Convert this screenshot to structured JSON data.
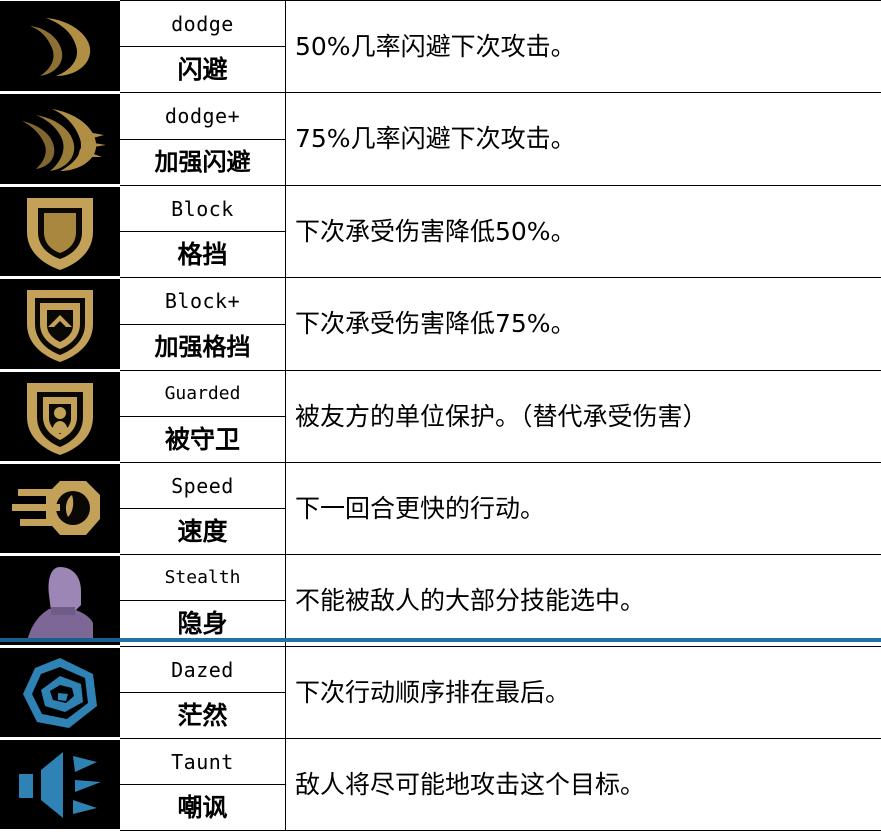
{
  "document": {
    "kind": "status-effect-reference-table",
    "column_count": 3,
    "row_count": 9,
    "separator_color": "#1f72a8",
    "icon_background": "#000000",
    "grid_color": "#000000",
    "page_background": "#ffffff"
  },
  "palette": {
    "gold_light": "#c9a85f",
    "gold_mid": "#a8873f",
    "gold_dark": "#6d5626",
    "purple_light": "#9b86b5",
    "purple_mid": "#7d6796",
    "blue_light": "#3f90c4",
    "blue_mid": "#2a7ba8",
    "blue_dark": "#1b5e8c",
    "black": "#000000",
    "white": "#ffffff"
  },
  "rows": [
    {
      "icon": "crescent-double-icon",
      "icon_color": "#a8873f",
      "name_en": "dodge",
      "name_cn": "闪避",
      "description": "50%几率闪避下次攻击。"
    },
    {
      "icon": "crescent-triple-icon",
      "icon_color": "#a8873f",
      "name_en": "dodge+",
      "name_cn": "加强闪避",
      "description": "75%几率闪避下次攻击。"
    },
    {
      "icon": "shield-icon",
      "icon_color": "#c9a85f",
      "name_en": "Block",
      "name_cn": "格挡",
      "description": "下次承受伤害降低50%。"
    },
    {
      "icon": "shield-chevron-icon",
      "icon_color": "#c9a85f",
      "name_en": "Block+",
      "name_cn": "加强格挡",
      "description": "下次承受伤害降低75%。"
    },
    {
      "icon": "shield-person-icon",
      "icon_color": "#c9a85f",
      "name_en": "Guarded",
      "name_cn": "被守卫",
      "description": "被友方的单位保护。（替代承受伤害）"
    },
    {
      "icon": "speed-gauge-icon",
      "icon_color": "#c9a85f",
      "name_en": "Speed",
      "name_cn": "速度",
      "description": "下一回合更快的行动。"
    },
    {
      "icon": "hooded-figure-icon",
      "icon_color": "#9b86b5",
      "name_en": "Stealth",
      "name_cn": "隐身",
      "description": "不能被敌人的大部分技能选中。"
    },
    {
      "icon": "spiral-icon",
      "icon_color": "#2a7ba8",
      "name_en": "Dazed",
      "name_cn": "茫然",
      "description": "下次行动顺序排在最后。"
    },
    {
      "icon": "speaker-icon",
      "icon_color": "#2a7ba8",
      "name_en": "Taunt",
      "name_cn": "嘲讽",
      "description": "敌人将尽可能地攻击这个目标。"
    }
  ]
}
